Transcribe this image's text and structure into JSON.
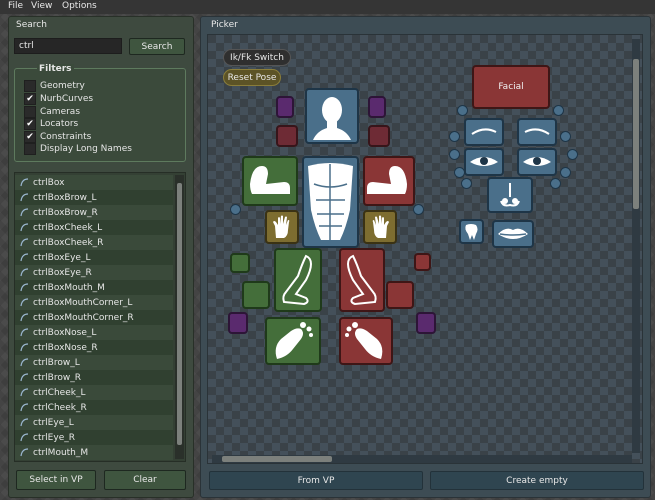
{
  "menu": {
    "file": "File",
    "view": "View",
    "options": "Options"
  },
  "search": {
    "title": "Search",
    "query": "ctrl",
    "button": "Search",
    "filters_title": "Filters",
    "filters": [
      {
        "label": "Geometry",
        "checked": false
      },
      {
        "label": "NurbCurves",
        "checked": true
      },
      {
        "label": "Cameras",
        "checked": false
      },
      {
        "label": "Locators",
        "checked": true
      },
      {
        "label": "Constraints",
        "checked": true
      },
      {
        "label": "Display Long Names",
        "checked": false
      }
    ],
    "results": [
      "ctrlBox",
      "ctrlBoxBrow_L",
      "ctrlBoxBrow_R",
      "ctrlBoxCheek_L",
      "ctrlBoxCheek_R",
      "ctrlBoxEye_L",
      "ctrlBoxEye_R",
      "ctrlBoxMouth_M",
      "ctrlBoxMouthCorner_L",
      "ctrlBoxMouthCorner_R",
      "ctrlBoxNose_L",
      "ctrlBoxNose_R",
      "ctrlBrow_L",
      "ctrlBrow_R",
      "ctrlCheek_L",
      "ctrlCheek_R",
      "ctrlEye_L",
      "ctrlEye_R",
      "ctrlMouth_M"
    ],
    "select_in_vp": "Select in VP",
    "clear": "Clear"
  },
  "picker": {
    "title": "Picker",
    "ikfk_switch": "Ik/Fk Switch",
    "reset_pose": "Reset Pose",
    "facial": "Facial",
    "from_vp": "From VP",
    "create_empty": "Create empty"
  },
  "colors": {
    "green": "#446e3a",
    "red": "#8a3636",
    "blue": "#4a6f8a",
    "gold": "#7d6d30",
    "purple": "#5a2a6e"
  }
}
